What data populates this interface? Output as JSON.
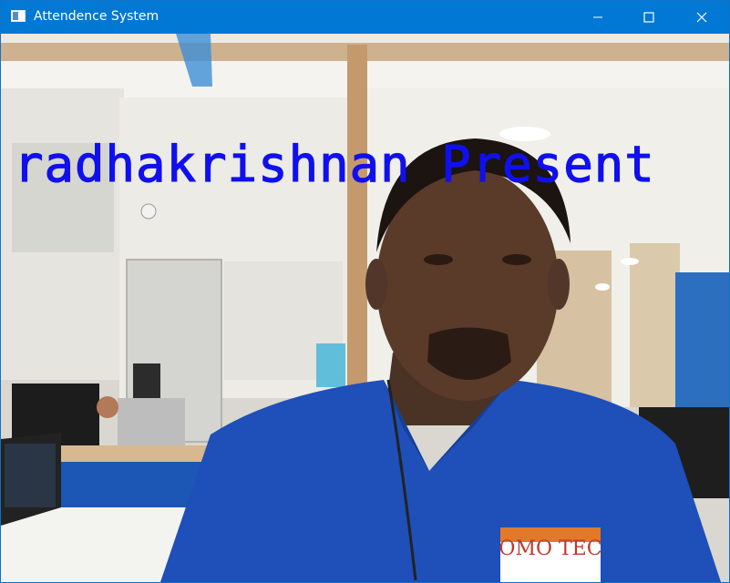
{
  "window": {
    "title": "Attendence System"
  },
  "overlay": {
    "recognition_text": "radhakrishnan Present"
  },
  "camera_feed": {
    "shirt_logo": "OMO TEC"
  },
  "colors": {
    "titlebar": "#0078d4",
    "overlay_text": "#1010ee",
    "shirt": "#1f4fb8"
  }
}
